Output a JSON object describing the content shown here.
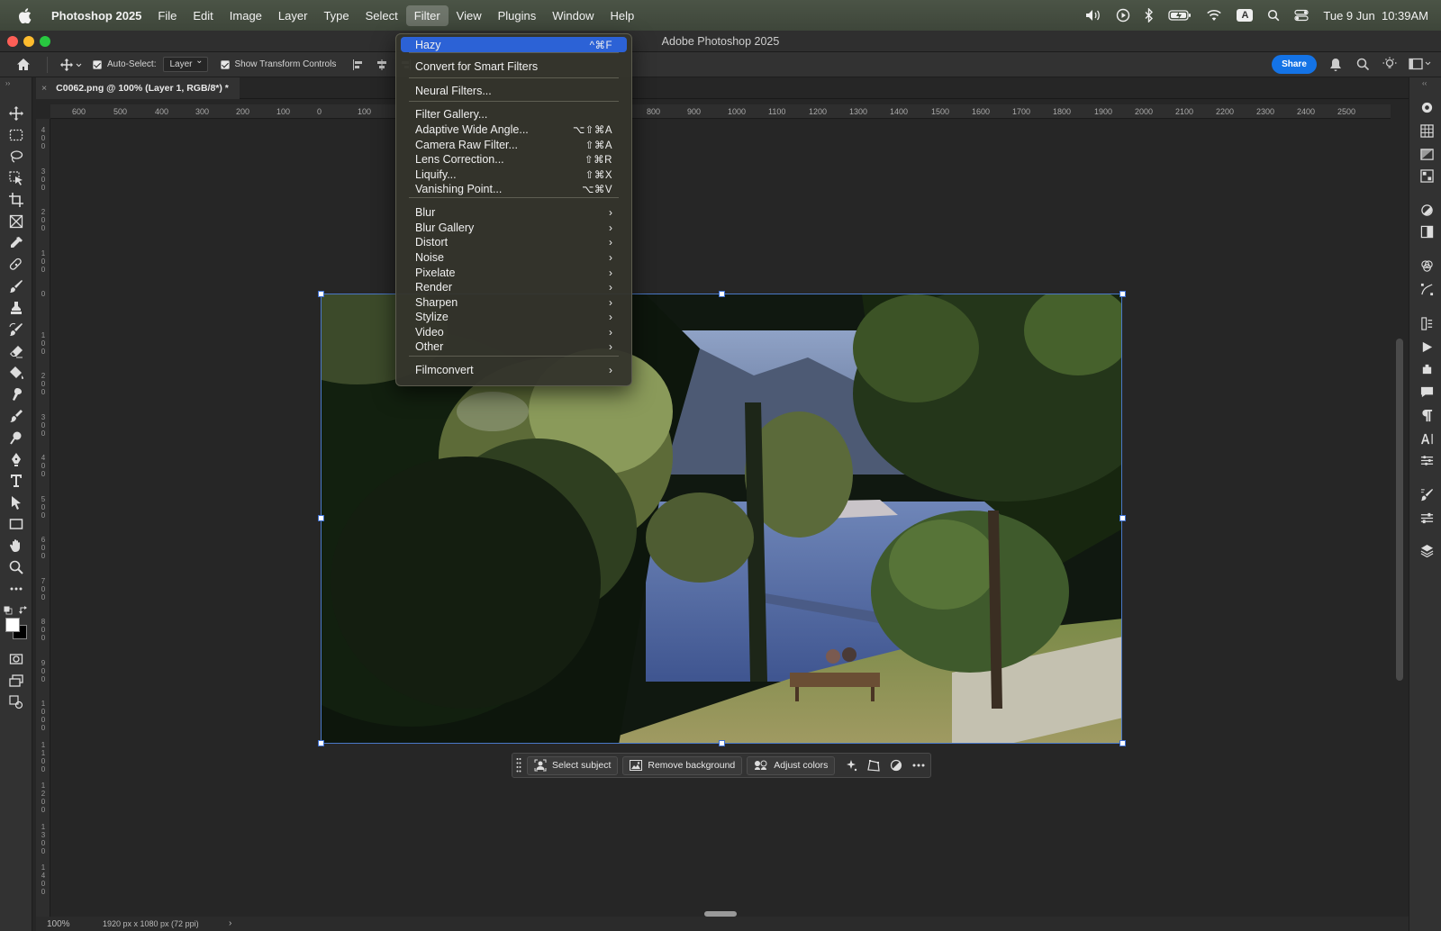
{
  "menubar": {
    "app_name": "Photoshop 2025",
    "items": [
      "File",
      "Edit",
      "Image",
      "Layer",
      "Type",
      "Select",
      "Filter",
      "View",
      "Plugins",
      "Window",
      "Help"
    ],
    "active_item": "Filter",
    "input_badge": "A",
    "datetime": "Tue 9 Jun  10:39AM"
  },
  "window": {
    "title": "Adobe Photoshop 2025"
  },
  "options_bar": {
    "auto_select_label": "Auto-Select:",
    "auto_select_value": "Layer",
    "transform_controls_label": "Show Transform Controls",
    "share_label": "Share"
  },
  "document_tab": {
    "title": "C0062.png @ 100% (Layer 1, RGB/8*) *",
    "close": "×"
  },
  "ruler": {
    "h_ticks": [
      "600",
      "500",
      "400",
      "300",
      "200",
      "100",
      "0",
      "100",
      "800",
      "900",
      "1000",
      "1100",
      "1200",
      "1300",
      "1400",
      "1500",
      "1600",
      "1700",
      "1800",
      "1900",
      "2000",
      "2100",
      "2200",
      "2300",
      "2400",
      "2500"
    ],
    "v_ticks": [
      "400",
      "300",
      "200",
      "100",
      "0",
      "100",
      "200",
      "300",
      "400",
      "500",
      "600",
      "700",
      "800",
      "900",
      "1000",
      "1100",
      "1200",
      "1300",
      "1400"
    ]
  },
  "filter_menu": {
    "items": [
      {
        "label": "Hazy",
        "shortcut": "^⌘F",
        "highlighted": true
      },
      {
        "label": "Convert for Smart Filters",
        "shortcut": ""
      },
      {
        "label": "Neural Filters...",
        "shortcut": ""
      },
      {
        "label": "Filter Gallery...",
        "shortcut": ""
      },
      {
        "label": "Adaptive Wide Angle...",
        "shortcut": "⌥⇧⌘A"
      },
      {
        "label": "Camera Raw Filter...",
        "shortcut": "⇧⌘A"
      },
      {
        "label": "Lens Correction...",
        "shortcut": "⇧⌘R"
      },
      {
        "label": "Liquify...",
        "shortcut": "⇧⌘X"
      },
      {
        "label": "Vanishing Point...",
        "shortcut": "⌥⌘V"
      },
      {
        "label": "Blur",
        "submenu": true
      },
      {
        "label": "Blur Gallery",
        "submenu": true
      },
      {
        "label": "Distort",
        "submenu": true
      },
      {
        "label": "Noise",
        "submenu": true
      },
      {
        "label": "Pixelate",
        "submenu": true
      },
      {
        "label": "Render",
        "submenu": true
      },
      {
        "label": "Sharpen",
        "submenu": true
      },
      {
        "label": "Stylize",
        "submenu": true
      },
      {
        "label": "Video",
        "submenu": true
      },
      {
        "label": "Other",
        "submenu": true
      },
      {
        "label": "Filmconvert",
        "submenu": true
      }
    ]
  },
  "task_bar": {
    "select_subject": "Select subject",
    "remove_background": "Remove background",
    "adjust_colors": "Adjust colors"
  },
  "status_bar": {
    "zoom": "100%",
    "doc_info": "1920 px x 1080 px (72 ppi)",
    "arrow": "›"
  },
  "colors": {
    "accent": "#2c62d6",
    "share": "#1473e6",
    "menubar": "#454e40"
  }
}
